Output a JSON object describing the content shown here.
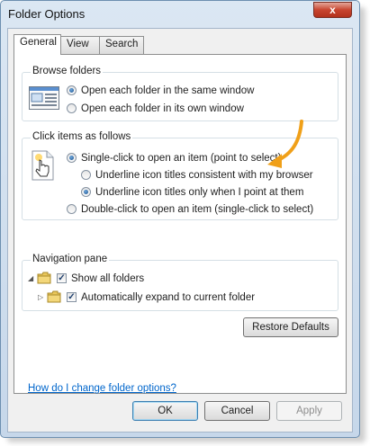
{
  "window": {
    "title": "Folder Options",
    "close_glyph": "x"
  },
  "tabs": [
    {
      "label": "General",
      "active": true
    },
    {
      "label": "View",
      "active": false
    },
    {
      "label": "Search",
      "active": false
    }
  ],
  "browse_folders": {
    "title": "Browse folders",
    "options": [
      {
        "label": "Open each folder in the same window",
        "checked": true
      },
      {
        "label": "Open each folder in its own window",
        "checked": false
      }
    ]
  },
  "click_items": {
    "title": "Click items as follows",
    "single_click": {
      "label": "Single-click to open an item (point to select)",
      "checked": true
    },
    "sub_options": [
      {
        "label": "Underline icon titles consistent with my browser",
        "checked": false
      },
      {
        "label": "Underline icon titles only when I point at them",
        "checked": true
      }
    ],
    "double_click": {
      "label": "Double-click to open an item (single-click to select)",
      "checked": false
    }
  },
  "navigation_pane": {
    "title": "Navigation pane",
    "options": [
      {
        "label": "Show all folders",
        "checked": true
      },
      {
        "label": "Automatically expand to current folder",
        "checked": true
      }
    ]
  },
  "buttons": {
    "restore_defaults": "Restore Defaults",
    "ok": "OK",
    "cancel": "Cancel",
    "apply": "Apply"
  },
  "help_link": "How do I change folder options?",
  "colors": {
    "accent_arrow": "#f0a019",
    "link": "#0066cc"
  },
  "icons": {
    "browse": "folder-window-icon",
    "click": "hand-pointer-icon",
    "nav": "folder-tree-icon",
    "annotation": "curved-arrow-icon"
  }
}
